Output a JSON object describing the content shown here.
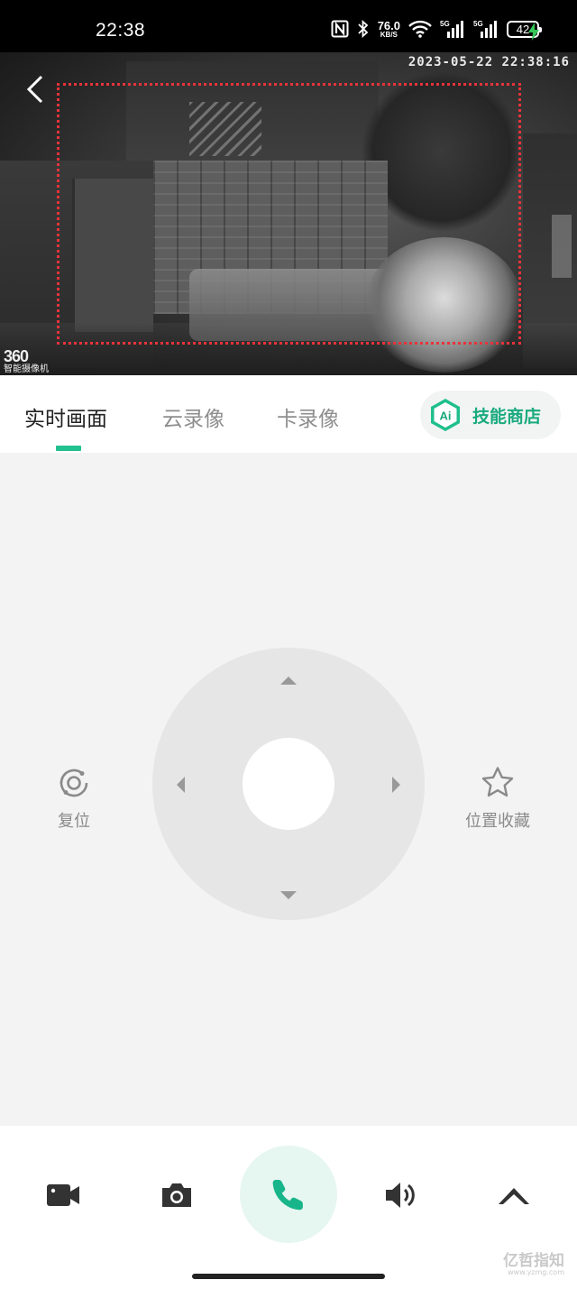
{
  "status_bar": {
    "time": "22:38",
    "net_speed_value": "76.0",
    "net_speed_unit": "KB/S",
    "sim1_tag": "5G",
    "sim2_tag": "5G",
    "battery": "42",
    "icons": [
      "nfc-icon",
      "bluetooth-icon",
      "wifi-icon",
      "signal-icon",
      "battery-icon",
      "charging-icon"
    ]
  },
  "video": {
    "timestamp": "2023-05-22  22:38:16",
    "logo_number": "360",
    "logo_text": "智能摄像机",
    "detection_box_color": "#e8333a"
  },
  "tabs": {
    "items": [
      {
        "label": "实时画面",
        "active": true
      },
      {
        "label": "云录像",
        "active": false
      },
      {
        "label": "卡录像",
        "active": false
      }
    ],
    "skill_store": {
      "badge": "Ai",
      "label": "技能商店"
    },
    "accent_color": "#22c08f"
  },
  "controls": {
    "reset_label": "复位",
    "favorite_label": "位置收藏",
    "ptz_directions": [
      "up",
      "down",
      "left",
      "right"
    ]
  },
  "bottom_bar": {
    "buttons": [
      "record-video",
      "snapshot",
      "call",
      "volume",
      "expand-up"
    ],
    "watermark_text": "亿哲指知",
    "watermark_url": "www.yzmg.com"
  }
}
